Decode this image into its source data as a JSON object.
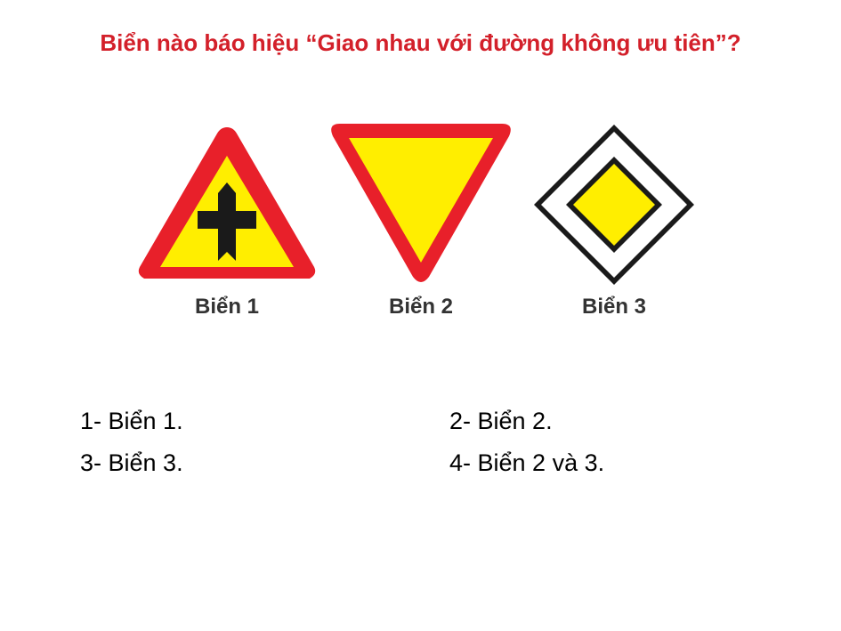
{
  "question": "Biển nào báo hiệu “Giao nhau với đường không ưu tiên”?",
  "signs": [
    {
      "label": "Biển 1",
      "icon": "priority-road-junction-warning-triangle-icon"
    },
    {
      "label": "Biển 2",
      "icon": "give-way-inverted-triangle-icon"
    },
    {
      "label": "Biển 3",
      "icon": "priority-road-diamond-icon"
    }
  ],
  "answers": [
    "1- Biển 1.",
    "2- Biển 2.",
    "3- Biển 3.",
    "4- Biển 2 và 3."
  ],
  "colors": {
    "question_text": "#d3202a",
    "sign_red": "#e8202a",
    "sign_yellow": "#ffee00",
    "sign_black": "#1a1a1a",
    "label_text": "#333333"
  }
}
